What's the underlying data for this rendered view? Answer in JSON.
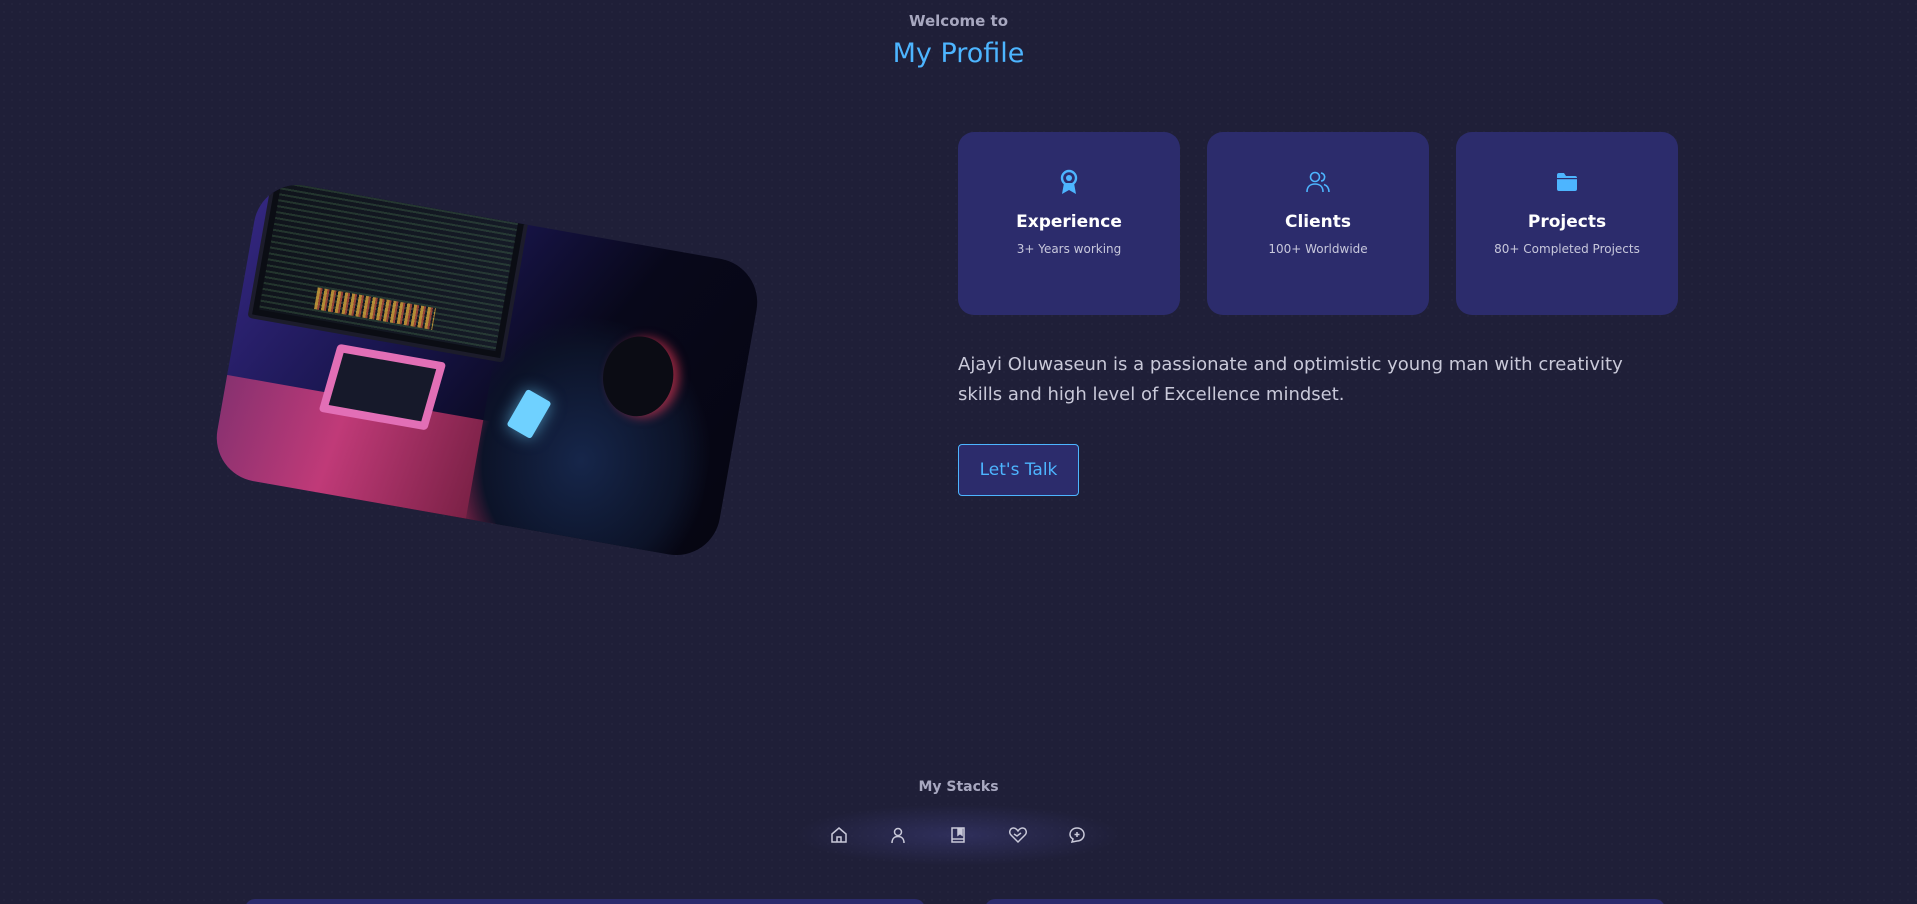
{
  "header": {
    "welcome": "Welcome to",
    "title": "My Profile"
  },
  "profile_image": {
    "description": "developer at computer workstation"
  },
  "cards": [
    {
      "icon": "award-icon",
      "title": "Experience",
      "subtitle": "3+ Years working"
    },
    {
      "icon": "users-icon",
      "title": "Clients",
      "subtitle": "100+ Worldwide"
    },
    {
      "icon": "folder-icon",
      "title": "Projects",
      "subtitle": "80+ Completed Projects"
    }
  ],
  "about": {
    "text": "Ajayi Oluwaseun is a passionate and optimistic young man with creativity skills and high level of Excellence mindset."
  },
  "cta": {
    "label": "Let's Talk"
  },
  "stacks": {
    "label": "My Stacks"
  },
  "nav": {
    "items": [
      {
        "icon": "home-icon"
      },
      {
        "icon": "user-icon"
      },
      {
        "icon": "book-icon"
      },
      {
        "icon": "services-icon"
      },
      {
        "icon": "message-icon"
      }
    ]
  },
  "colors": {
    "background": "#1f1f38",
    "accent": "#4db5ff",
    "card": "#2c2c6c",
    "text_muted": "#c9c9d9"
  }
}
